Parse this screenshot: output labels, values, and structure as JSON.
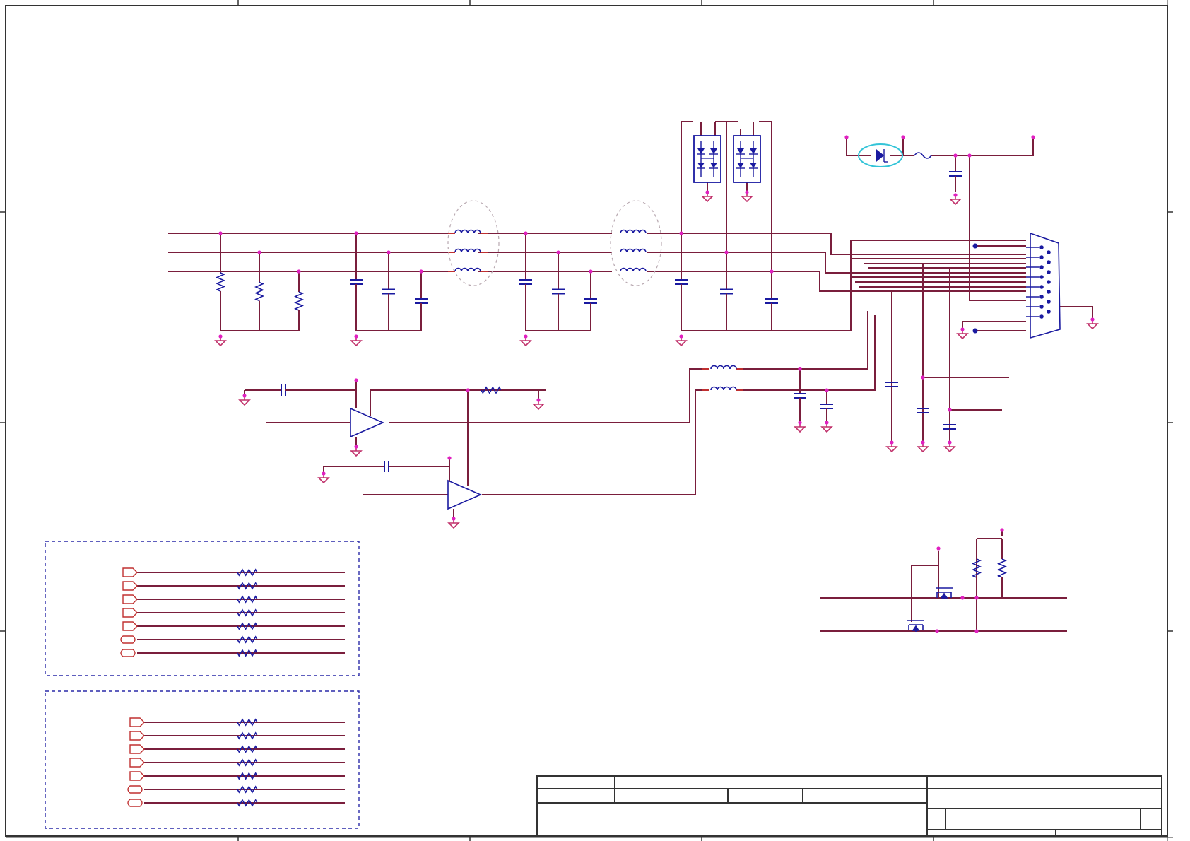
{
  "page": {
    "title": ""
  },
  "colors": {
    "wire": "#7a1e3c",
    "component": "#1a1aa0",
    "node": "#e020c0",
    "ground": "#c0306a",
    "frame": "#333333",
    "highlight": "#33c4d8",
    "dashed_box": "#2a2aa8",
    "ferrite_outline": "#b8a8b0",
    "port": "#c03030"
  },
  "icons": {
    "resistor": "resistor-icon",
    "capacitor": "capacitor-icon",
    "inductor": "inductor-icon",
    "ground": "ground-icon",
    "op_amp": "op-amp-icon",
    "diode": "diode-icon",
    "mosfet": "mosfet-icon",
    "connector": "db15-connector-icon",
    "port": "port-icon"
  },
  "title_block": {
    "cells": [
      "",
      "",
      "",
      "",
      "",
      "",
      "",
      "",
      ""
    ]
  }
}
